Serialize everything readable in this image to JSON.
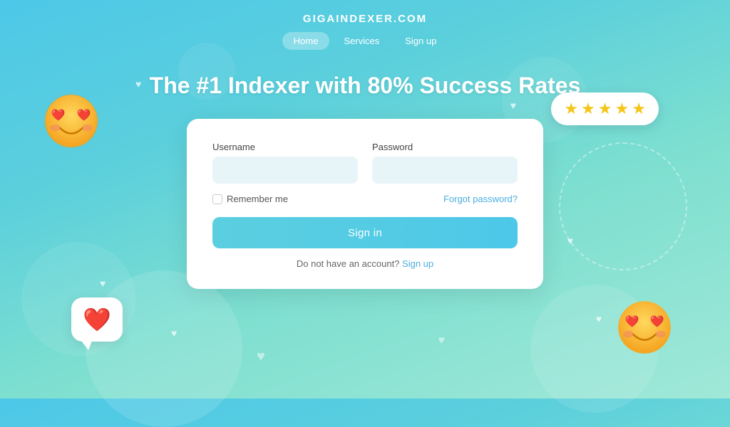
{
  "site": {
    "title": "GIGAINDEXER.COM"
  },
  "nav": {
    "items": [
      {
        "label": "Home",
        "active": true
      },
      {
        "label": "Services",
        "active": false
      },
      {
        "label": "Sign up",
        "active": false
      }
    ]
  },
  "hero": {
    "title": "The #1 Indexer with 80% Success Rates"
  },
  "form": {
    "username_label": "Username",
    "password_label": "Password",
    "username_placeholder": "",
    "password_placeholder": "",
    "remember_label": "Remember me",
    "forgot_label": "Forgot password?",
    "signin_label": "Sign in",
    "no_account_label": "Do not have an account?",
    "signup_link_label": "Sign up"
  },
  "stars": {
    "count": 5,
    "symbol": "★"
  },
  "decorations": {
    "hearts": [
      "♥",
      "♥",
      "♥",
      "♥",
      "♥",
      "♥"
    ]
  }
}
